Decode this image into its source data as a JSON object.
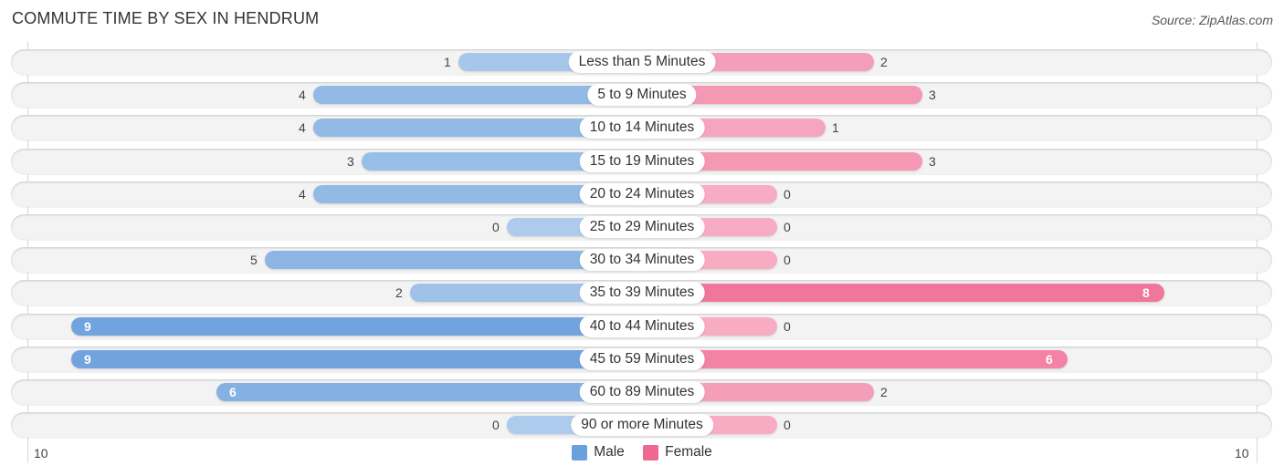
{
  "header": {
    "title": "COMMUTE TIME BY SEX IN HENDRUM",
    "source": "Source: ZipAtlas.com"
  },
  "chart_data": {
    "type": "bar",
    "orientation": "horizontal-diverging",
    "title": "COMMUTE TIME BY SEX IN HENDRUM",
    "categories": [
      "Less than 5 Minutes",
      "5 to 9 Minutes",
      "10 to 14 Minutes",
      "15 to 19 Minutes",
      "20 to 24 Minutes",
      "25 to 29 Minutes",
      "30 to 34 Minutes",
      "35 to 39 Minutes",
      "40 to 44 Minutes",
      "45 to 59 Minutes",
      "60 to 89 Minutes",
      "90 or more Minutes"
    ],
    "series": [
      {
        "name": "Male",
        "color": "#6aa0dc",
        "values": [
          1,
          4,
          4,
          3,
          4,
          0,
          5,
          2,
          9,
          9,
          6,
          0
        ]
      },
      {
        "name": "Female",
        "color": "#f06892",
        "values": [
          2,
          3,
          1,
          3,
          0,
          0,
          0,
          8,
          0,
          6,
          2,
          0
        ]
      }
    ],
    "axis": {
      "left_label": "10",
      "right_label": "10",
      "max": 10
    },
    "legend": {
      "position": "bottom-center",
      "items": [
        "Male",
        "Female"
      ]
    },
    "grid": false
  }
}
